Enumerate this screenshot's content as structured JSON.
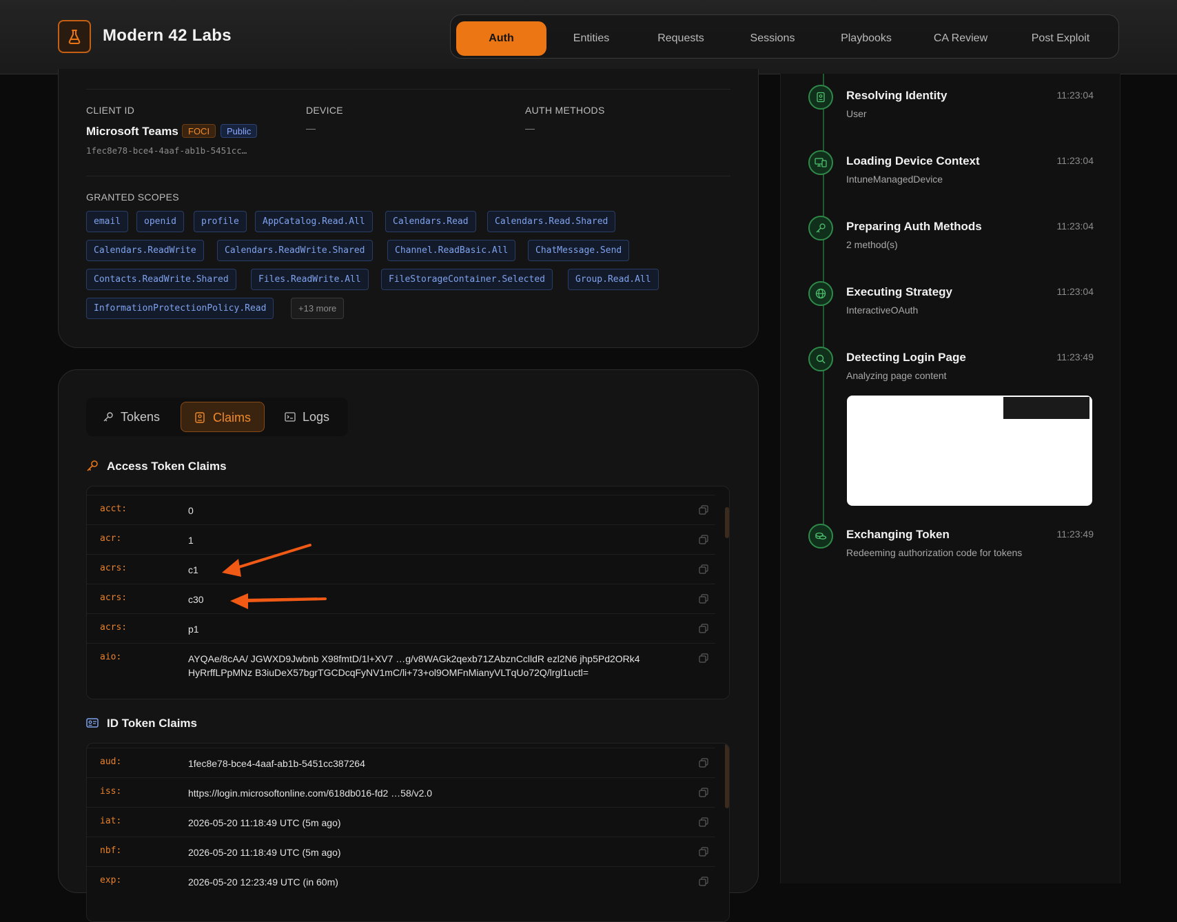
{
  "header": {
    "brand": "Modern 42 Labs",
    "nav": [
      "Auth",
      "Entities",
      "Requests",
      "Sessions",
      "Playbooks",
      "CA Review",
      "Post Exploit"
    ],
    "active_nav": "Auth"
  },
  "client": {
    "client_id_label": "CLIENT ID",
    "device_label": "DEVICE",
    "auth_methods_label": "AUTH METHODS",
    "name": "Microsoft Teams",
    "badge_foci": "FOCI",
    "badge_public": "Public",
    "id": "1fec8e78-bce4-4aaf-ab1b-5451cc…",
    "device_value": "—",
    "auth_methods_value": "—"
  },
  "scopes": {
    "label": "GRANTED SCOPES",
    "items": [
      "email",
      "openid",
      "profile",
      "AppCatalog.Read.All",
      "Calendars.Read",
      "Calendars.Read.Shared",
      "Calendars.ReadWrite",
      "Calendars.ReadWrite.Shared",
      "Channel.ReadBasic.All",
      "ChatMessage.Send",
      "Contacts.ReadWrite.Shared",
      "Files.ReadWrite.All",
      "FileStorageContainer.Selected",
      "Group.Read.All",
      "InformationProtectionPolicy.Read"
    ],
    "more": "+13 more"
  },
  "tabs": [
    "Tokens",
    "Claims",
    "Logs"
  ],
  "access_claims": {
    "title": "Access Token Claims",
    "rows": [
      {
        "k": "acct:",
        "v": "0"
      },
      {
        "k": "acr:",
        "v": "1"
      },
      {
        "k": "acrs:",
        "v": "c1"
      },
      {
        "k": "acrs:",
        "v": "c30"
      },
      {
        "k": "acrs:",
        "v": "p1"
      },
      {
        "k": "aio:",
        "v": "AYQAe/8cAA/ JGWXD9Jwbnb X98fmtD/1l+XV7 …g/v8WAGk2qexb71ZAbznCclldR ezl2N6 jhp5Pd2ORk4HyRrffLPpMNz B3iuDeX57bgrTGCDcqFyNV1mC/li+73+ol9OMFnMianyVLTqUo72Q/lrgl1uctl="
      }
    ]
  },
  "id_claims": {
    "title": "ID Token Claims",
    "rows": [
      {
        "k": "aud:",
        "v": "1fec8e78-bce4-4aaf-ab1b-5451cc387264"
      },
      {
        "k": "iss:",
        "v": "https://login.microsoftonline.com/618db016-fd2 …58/v2.0"
      },
      {
        "k": "iat:",
        "v": "2026-05-20 11:18:49 UTC (5m ago)"
      },
      {
        "k": "nbf:",
        "v": "2026-05-20 11:18:49 UTC (5m ago)"
      },
      {
        "k": "exp:",
        "v": "2026-05-20 12:23:49 UTC (in 60m)"
      }
    ]
  },
  "timeline": [
    {
      "title": "Resolving Identity",
      "sub": "User",
      "time": "11:23:04",
      "icon": "user-badge-icon"
    },
    {
      "title": "Loading Device Context",
      "sub": "IntuneManagedDevice",
      "time": "11:23:04",
      "icon": "devices-icon"
    },
    {
      "title": "Preparing Auth Methods",
      "sub": "2 method(s)",
      "time": "11:23:04",
      "icon": "key-icon"
    },
    {
      "title": "Executing Strategy",
      "sub": "InteractiveOAuth",
      "time": "11:23:04",
      "icon": "globe-icon"
    },
    {
      "title": "Detecting Login Page",
      "sub": "Analyzing page content",
      "time": "11:23:49",
      "icon": "search-icon"
    },
    {
      "title": "Exchanging Token",
      "sub": "Redeeming authorization code for tokens",
      "time": "11:23:49",
      "icon": "coins-icon"
    }
  ],
  "colors": {
    "accent": "#ec7613",
    "scope_text": "#7fa2ee",
    "timeline_green": "#2f8a4a"
  }
}
